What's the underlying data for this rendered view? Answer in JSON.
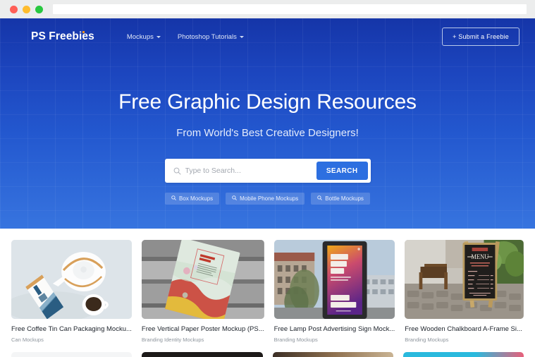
{
  "browser": {
    "traffic_lights": [
      "close-red",
      "minimize-yellow",
      "maximize-green"
    ],
    "address_value": ""
  },
  "navbar": {
    "logo": "PS Freebies",
    "links": [
      {
        "label": "Mockups",
        "icon": "chevron-down-icon"
      },
      {
        "label": "Photoshop Tutorials",
        "icon": "chevron-down-icon"
      }
    ],
    "submit_label": "+ Submit a Freebie"
  },
  "hero": {
    "title": "Free Graphic Design Resources",
    "subtitle": "From World's Best Creative Designers!",
    "bg_top_color": "#1535a8",
    "bg_bottom_color": "#3774df"
  },
  "search": {
    "icon": "search-icon",
    "placeholder": "Type to Search...",
    "value": "",
    "button_label": "SEARCH",
    "button_color": "#2d6fe0"
  },
  "tags": [
    {
      "label": "Box Mockups",
      "icon": "search-icon"
    },
    {
      "label": "Mobile Phone Mockups",
      "icon": "search-icon"
    },
    {
      "label": "Bottle Mockups",
      "icon": "search-icon"
    }
  ],
  "cards": [
    {
      "title": "Free Coffee Tin Can Packaging Mocku...",
      "category": "Can Mockups",
      "thumb_name": "coffee-tin-can-thumbnail"
    },
    {
      "title": "Free Vertical Paper Poster Mockup (PS...",
      "category": "Branding Identity Mockups",
      "thumb_name": "vertical-paper-poster-thumbnail"
    },
    {
      "title": "Free Lamp Post Advertising Sign Mock...",
      "category": "Branding Mockups",
      "thumb_name": "lamp-post-sign-thumbnail"
    },
    {
      "title": "Free Wooden Chalkboard A-Frame Si...",
      "category": "Branding Mockups",
      "thumb_name": "wooden-chalkboard-thumbnail"
    }
  ],
  "cards_row2": [
    {
      "thumb_name": "next-row-thumbnail-1",
      "color": "#f4f5f6"
    },
    {
      "thumb_name": "next-row-thumbnail-2",
      "color": "#1d1a19"
    },
    {
      "thumb_name": "next-row-thumbnail-3",
      "color": "#6b5440"
    },
    {
      "thumb_name": "next-row-thumbnail-4",
      "color": "#2ab9dd"
    }
  ]
}
